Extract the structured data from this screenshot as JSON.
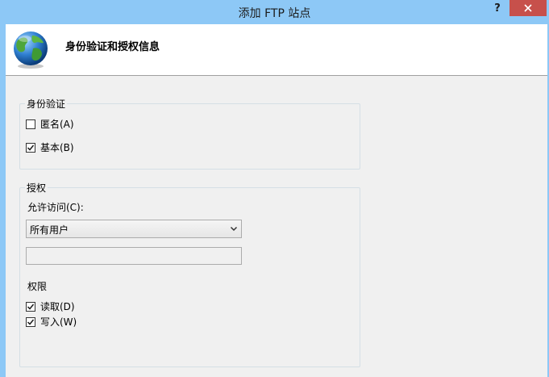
{
  "window": {
    "title": "添加 FTP 站点",
    "help": "?",
    "close": "✕"
  },
  "header": {
    "title": "身份验证和授权信息",
    "icon": "globe-icon"
  },
  "auth": {
    "legend": "身份验证",
    "anonymous": {
      "label": "匿名(A)",
      "checked": false
    },
    "basic": {
      "label": "基本(B)",
      "checked": true
    }
  },
  "authorization": {
    "legend": "授权",
    "allow_label": "允许访问(C):",
    "allow_value": "所有用户",
    "user_input": "",
    "permissions_label": "权限",
    "read": {
      "label": "读取(D)",
      "checked": true
    },
    "write": {
      "label": "写入(W)",
      "checked": true
    }
  },
  "colors": {
    "titlebar": "#8dc8f6",
    "close": "#c7504b",
    "body": "#f0f0f0"
  }
}
